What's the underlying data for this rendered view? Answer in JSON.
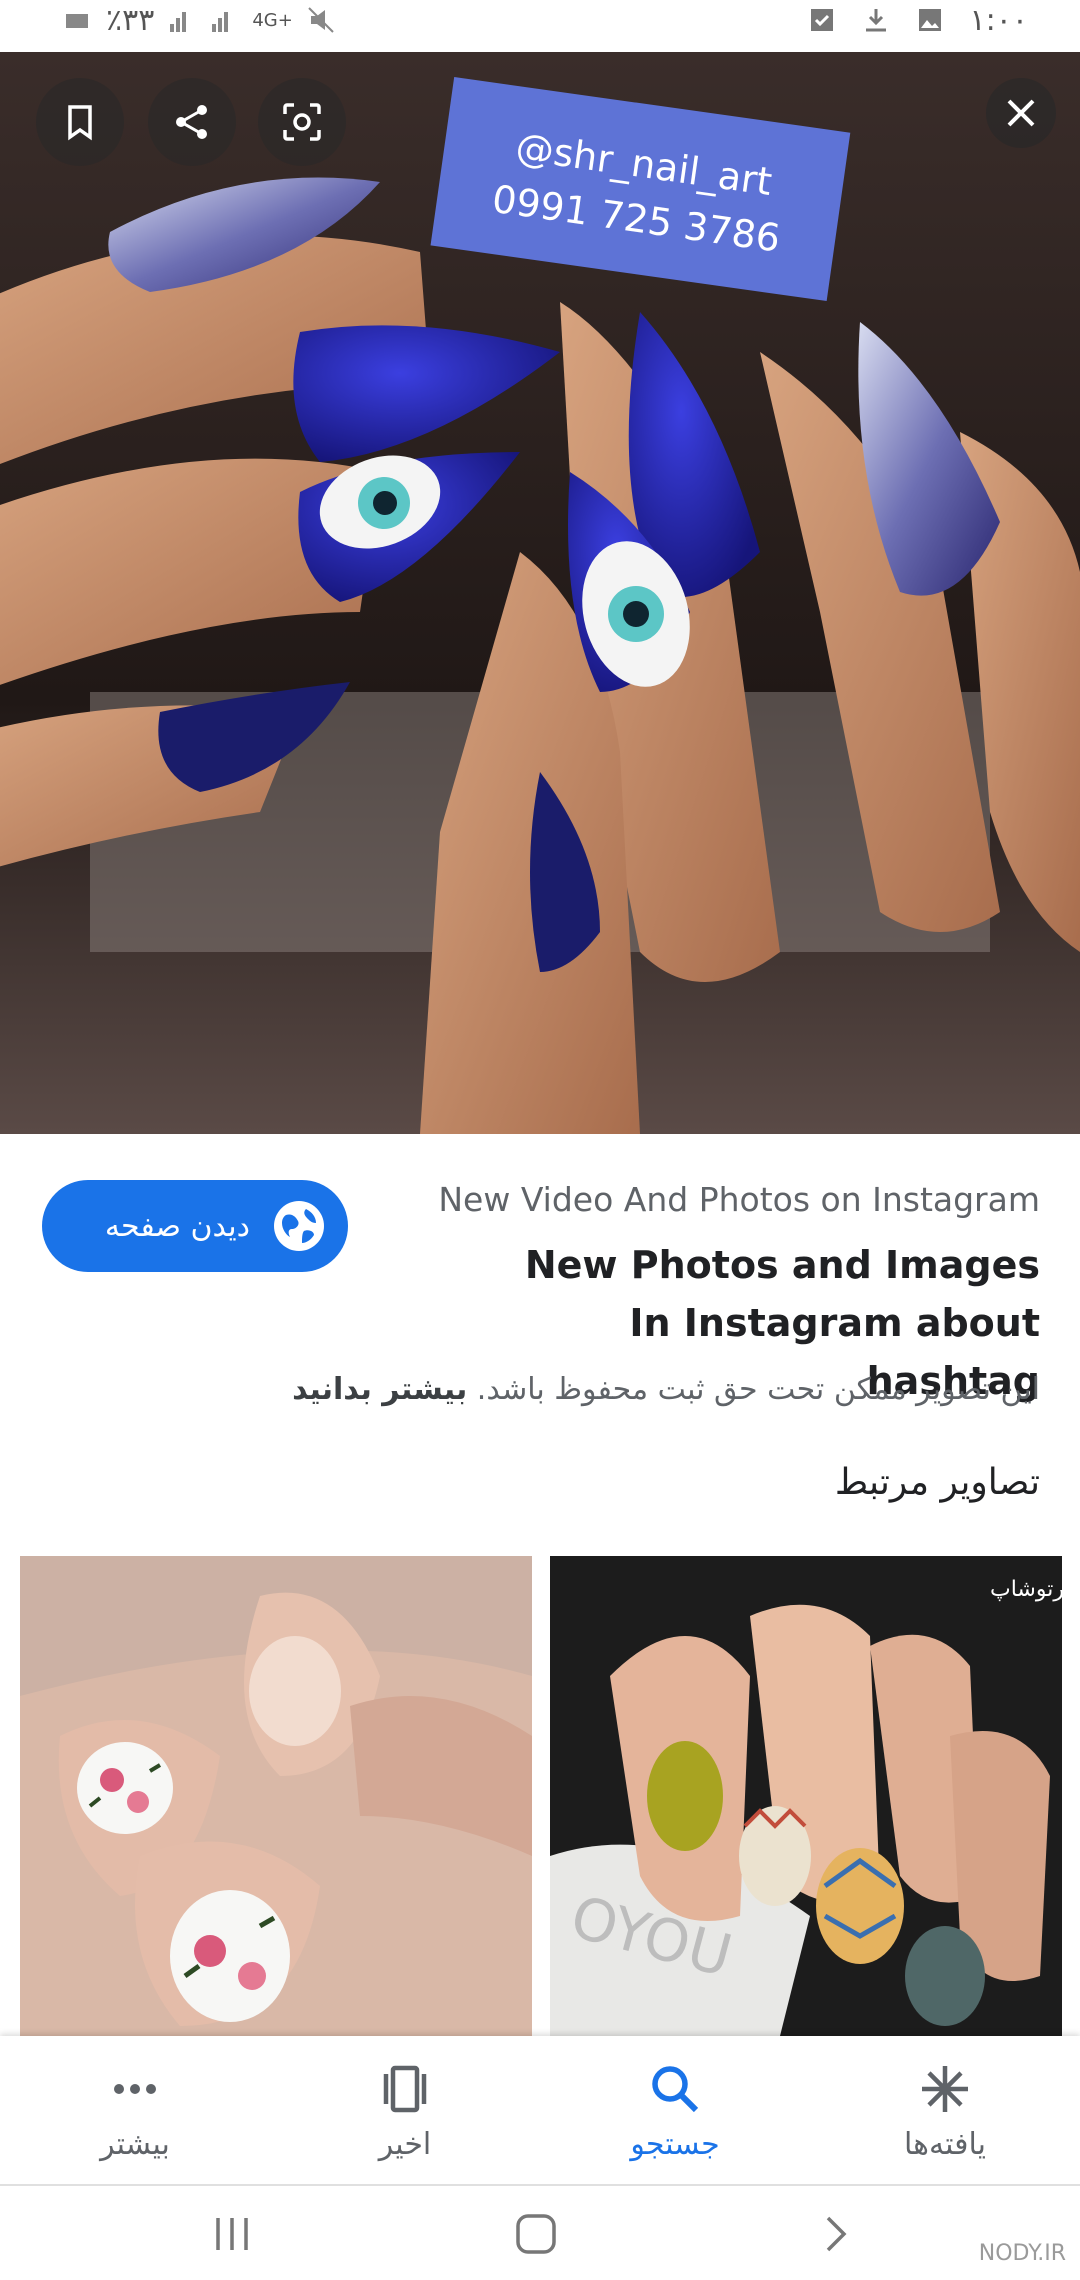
{
  "status_bar": {
    "time": "۱:۰۰",
    "battery": "٪۳۳",
    "network": "4G+"
  },
  "hero": {
    "overlay_line1": "@shr_nail_art",
    "overlay_line2": "0991 725 3786",
    "buttons": [
      "bookmark-icon",
      "share-icon",
      "lens-icon"
    ],
    "close_icon": "close-icon"
  },
  "info": {
    "source": "New Video And Photos on Instagram",
    "title": "New Photos and Images In Instagram about hashtag",
    "visit_button": "دیدن صفحه",
    "copyright_text": "این تصویر ممکن تحت حق ثبت محفوظ باشد.",
    "learn_more": "بیشتر بدانید",
    "related_heading": "تصاویر مرتبط"
  },
  "related_thumbs": [
    {
      "watermark": "برتوشاپ"
    },
    {
      "watermark": ""
    }
  ],
  "bottom_nav": [
    {
      "label": "یافته‌ها",
      "icon": "asterisk-icon",
      "active": false
    },
    {
      "label": "جستجو",
      "icon": "search-icon",
      "active": true
    },
    {
      "label": "اخیر",
      "icon": "recent-cards-icon",
      "active": false
    },
    {
      "label": "بیشتر",
      "icon": "more-dots-icon",
      "active": false
    }
  ],
  "colors": {
    "accent": "#1a73e8",
    "text_primary": "#202124",
    "text_secondary": "#5f6368"
  },
  "footer_watermark": "NODY.IR"
}
